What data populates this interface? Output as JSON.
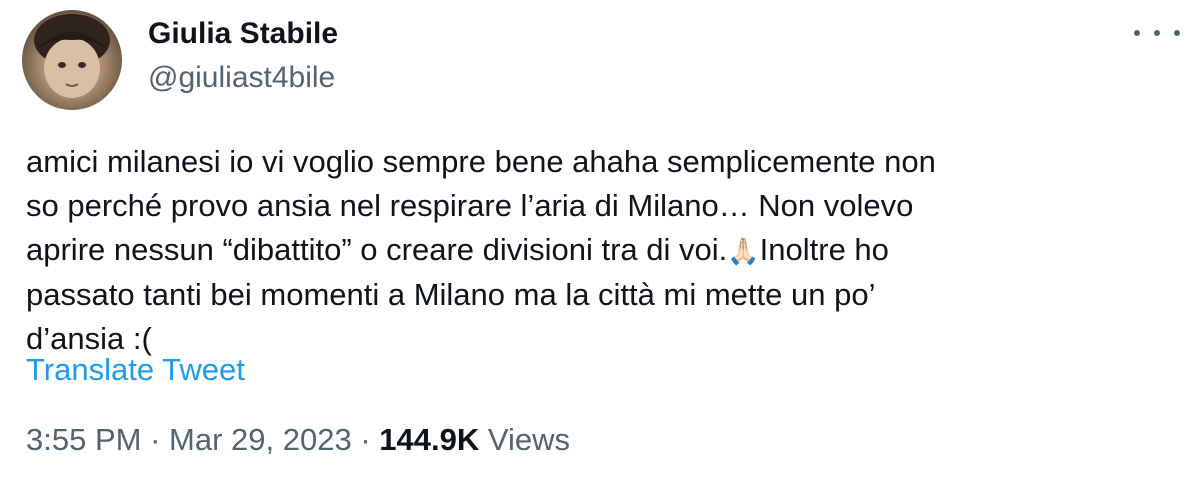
{
  "author": {
    "display_name": "Giulia Stabile",
    "handle": "@giuliast4bile"
  },
  "tweet": {
    "lines": [
      "amici milanesi io vi voglio sempre bene ahaha semplicemente non",
      "so perché provo ansia nel respirare l’aria di Milano… Non volevo",
      "aprire nessun “dibattito” o creare divisioni tra di voi.",
      "passato tanti bei momenti a Milano ma la città mi mette un po’",
      "d’ansia :("
    ],
    "line3_emoji": "🙏🏻",
    "line3_after": "Inoltre ho",
    "translate_label": "Translate Tweet"
  },
  "meta": {
    "time": "3:55 PM",
    "separator": "·",
    "date": "Mar 29, 2023",
    "views_count": "144.9K",
    "views_label": "Views"
  },
  "colors": {
    "link": "#1d9bf0",
    "secondary_text": "#536471",
    "primary_text": "#0f1419"
  },
  "icons": {
    "more": "more-horizontal-icon"
  }
}
